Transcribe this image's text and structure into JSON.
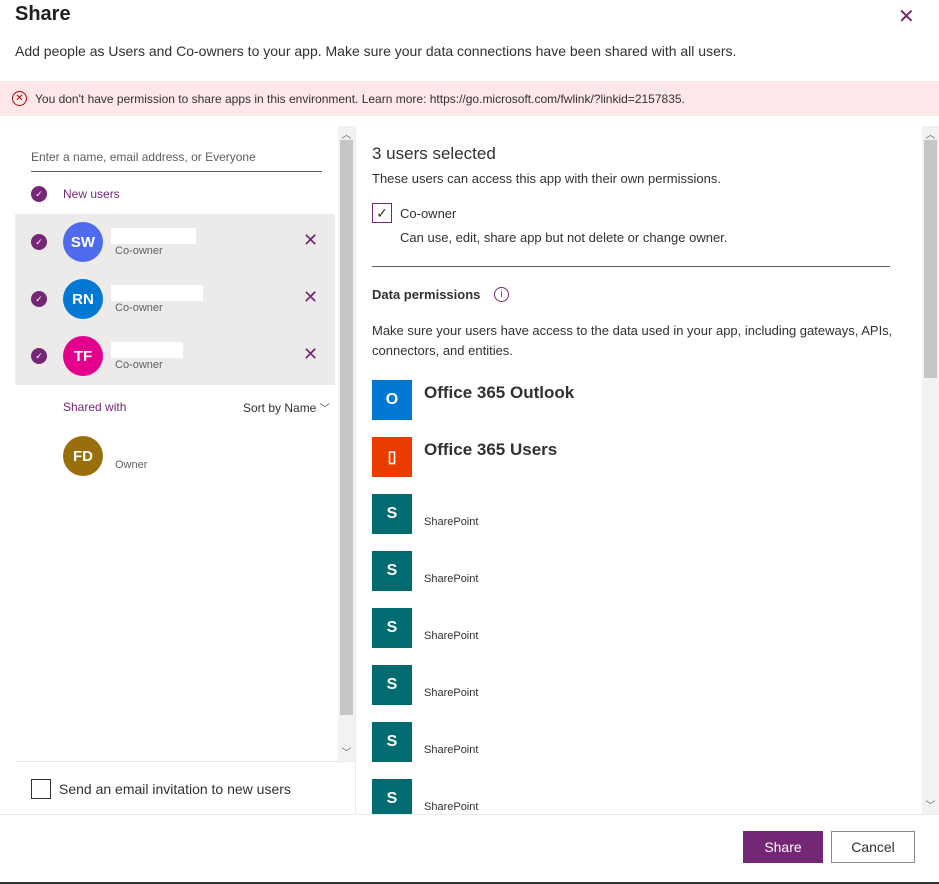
{
  "dialog": {
    "title": "Share",
    "subtitle": "Add people as Users and Co-owners to your app. Make sure your data connections have been shared with all users."
  },
  "banner": {
    "text": "You don't have permission to share apps in this environment. Learn more: https://go.microsoft.com/fwlink/?linkid=2157835.",
    "color": "#fde7e9"
  },
  "left": {
    "search_placeholder": "Enter a name, email address, or Everyone",
    "new_users_label": "New users",
    "new_users": [
      {
        "initials": "SW",
        "role": "Co-owner",
        "color": "#4f6bed"
      },
      {
        "initials": "RN",
        "role": "Co-owner",
        "color": "#0078d4"
      },
      {
        "initials": "TF",
        "role": "Co-owner",
        "color": "#e3008c"
      }
    ],
    "shared_with_label": "Shared with",
    "sort_label": "Sort by Name",
    "shared": [
      {
        "initials": "FD",
        "role": "Owner",
        "color": "#986f0b"
      }
    ],
    "email_invite_label": "Send an email invitation to new users"
  },
  "right": {
    "selected_count": "3 users selected",
    "selected_desc": "These users can access this app with their own permissions.",
    "coowner_label": "Co-owner",
    "coowner_checked": true,
    "coowner_desc": "Can use, edit, share app but not delete or change owner.",
    "data_perm_title": "Data permissions",
    "data_perm_desc": "Make sure your users have access to the data used in your app, including gateways, APIs, connectors, and entities.",
    "connectors": [
      {
        "name": "Office 365 Outlook",
        "icon": "outlook-icon"
      },
      {
        "name": "Office 365 Users",
        "icon": "office-icon"
      },
      {
        "name": "SharePoint",
        "icon": "sharepoint-icon"
      },
      {
        "name": "SharePoint",
        "icon": "sharepoint-icon"
      },
      {
        "name": "SharePoint",
        "icon": "sharepoint-icon"
      },
      {
        "name": "SharePoint",
        "icon": "sharepoint-icon"
      },
      {
        "name": "SharePoint",
        "icon": "sharepoint-icon"
      },
      {
        "name": "SharePoint",
        "icon": "sharepoint-icon"
      }
    ]
  },
  "footer": {
    "share_label": "Share",
    "cancel_label": "Cancel",
    "accent": "#742774"
  }
}
